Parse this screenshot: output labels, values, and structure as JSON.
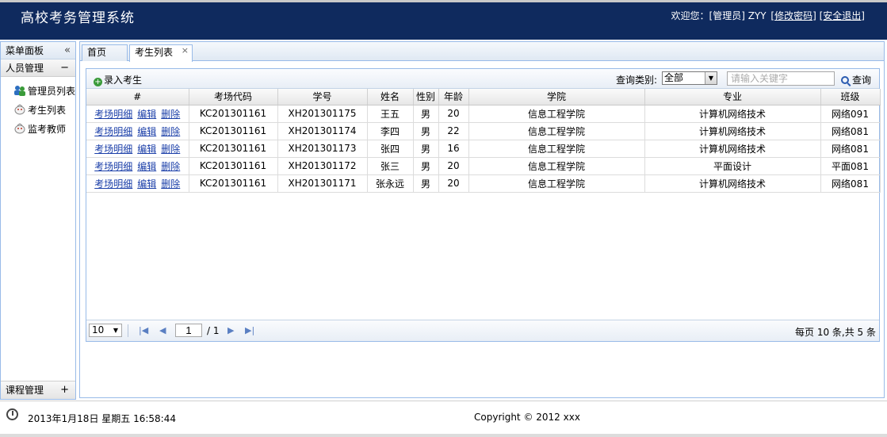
{
  "header": {
    "title": "高校考务管理系统",
    "welcome": "欢迎您：[管理员] ZYY",
    "change_password": "[修改密码]",
    "logout": "[安全退出]"
  },
  "sidebar": {
    "title": "菜单面板",
    "collapse_icon": "«",
    "groups": [
      {
        "label": "人员管理",
        "toggle": "−",
        "items": [
          {
            "label": "管理员列表",
            "icon": "users-icon"
          },
          {
            "label": "考生列表",
            "icon": "student-icon"
          },
          {
            "label": "监考教师",
            "icon": "teacher-icon"
          }
        ]
      },
      {
        "label": "课程管理",
        "toggle": "+"
      }
    ]
  },
  "tabs": [
    {
      "label": "首页"
    },
    {
      "label": "考生列表",
      "close": "×"
    }
  ],
  "toolbar": {
    "add_label": "录入考生",
    "query_label": "查询类别:",
    "query_select_value": "全部",
    "search_placeholder": "请输入关键字",
    "search_button": "查询"
  },
  "table": {
    "columns": [
      "#",
      "考场代码",
      "学号",
      "姓名",
      "性别",
      "年龄",
      "学院",
      "专业",
      "班级"
    ],
    "actions": [
      "考场明细",
      "编辑",
      "删除"
    ],
    "rows": [
      {
        "code": "KC201301161",
        "sid": "XH201301175",
        "name": "王五",
        "gender": "男",
        "age": "20",
        "college": "信息工程学院",
        "major": "计算机网络技术",
        "class": "网络091"
      },
      {
        "code": "KC201301161",
        "sid": "XH201301174",
        "name": "李四",
        "gender": "男",
        "age": "22",
        "college": "信息工程学院",
        "major": "计算机网络技术",
        "class": "网络081"
      },
      {
        "code": "KC201301161",
        "sid": "XH201301173",
        "name": "张四",
        "gender": "男",
        "age": "16",
        "college": "信息工程学院",
        "major": "计算机网络技术",
        "class": "网络081"
      },
      {
        "code": "KC201301161",
        "sid": "XH201301172",
        "name": "张三",
        "gender": "男",
        "age": "20",
        "college": "信息工程学院",
        "major": "平面设计",
        "class": "平面081"
      },
      {
        "code": "KC201301161",
        "sid": "XH201301171",
        "name": "张永远",
        "gender": "男",
        "age": "20",
        "college": "信息工程学院",
        "major": "计算机网络技术",
        "class": "网络081"
      }
    ]
  },
  "pager": {
    "page_size": "10",
    "page": "1",
    "total_pages": "/ 1",
    "info": "每页 10 条,共 5 条"
  },
  "footer": {
    "datetime": "2013年1月18日 星期五 16:58:44",
    "copyright": "Copyright © 2012 xxx"
  }
}
